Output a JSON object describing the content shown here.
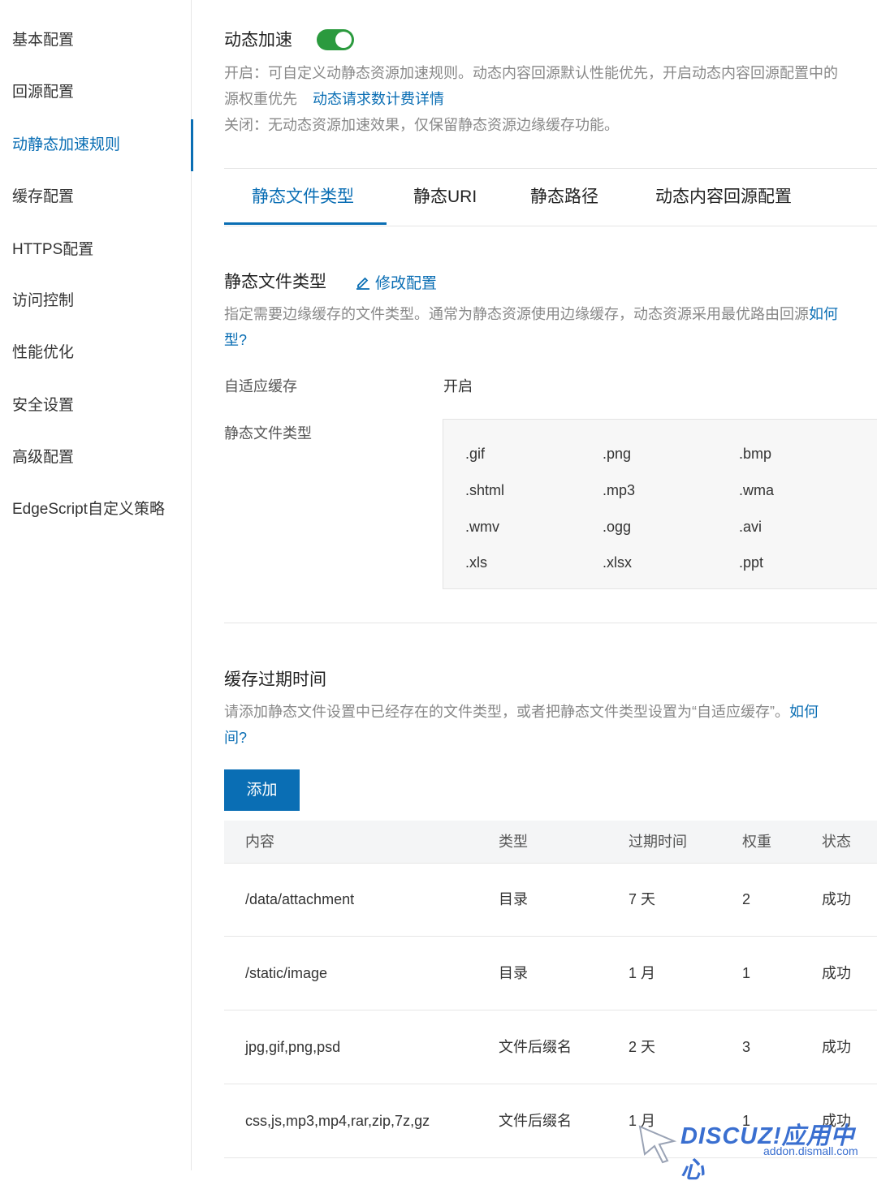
{
  "sidebar": {
    "items": [
      {
        "label": "基本配置"
      },
      {
        "label": "回源配置"
      },
      {
        "label": "动静态加速规则"
      },
      {
        "label": "缓存配置"
      },
      {
        "label": "HTTPS配置"
      },
      {
        "label": "访问控制"
      },
      {
        "label": "性能优化"
      },
      {
        "label": "安全设置"
      },
      {
        "label": "高级配置"
      },
      {
        "label": "EdgeScript自定义策略"
      }
    ]
  },
  "accel": {
    "title": "动态加速",
    "toggle_on": true,
    "desc_line1": "开启：可自定义动静态资源加速规则。动态内容回源默认性能优先，开启动态内容回源配置中的",
    "desc_line2_prefix": "源权重优先",
    "desc_link": "动态请求数计费详情",
    "desc_line3": "关闭：无动态资源加速效果，仅保留静态资源边缘缓存功能。"
  },
  "tabs": [
    {
      "label": "静态文件类型"
    },
    {
      "label": "静态URI"
    },
    {
      "label": "静态路径"
    },
    {
      "label": "动态内容回源配置"
    }
  ],
  "static_section": {
    "title": "静态文件类型",
    "edit_label": "修改配置",
    "desc_line1": "指定需要边缘缓存的文件类型。通常为静态资源使用边缘缓存，动态资源采用最优路由回源",
    "desc_link1": "如何",
    "desc_link2": "型?",
    "adaptive_label": "自适应缓存",
    "adaptive_value": "开启",
    "types_label": "静态文件类型",
    "extensions": [
      [
        ".gif",
        ".png",
        ".bmp"
      ],
      [
        ".shtml",
        ".mp3",
        ".wma"
      ],
      [
        ".wmv",
        ".ogg",
        ".avi"
      ],
      [
        ".xls",
        ".xlsx",
        ".ppt"
      ]
    ]
  },
  "cache_section": {
    "title": "缓存过期时间",
    "desc_line1": "请添加静态文件设置中已经存在的文件类型，或者把静态文件类型设置为“自适应缓存”。",
    "desc_link1": "如何",
    "desc_link2": "间?",
    "add_label": "添加",
    "columns": [
      "内容",
      "类型",
      "过期时间",
      "权重",
      "状态"
    ],
    "rows": [
      [
        "/data/attachment",
        "目录",
        "7 天",
        "2",
        "成功"
      ],
      [
        "/static/image",
        "目录",
        "1 月",
        "1",
        "成功"
      ],
      [
        "jpg,gif,png,psd",
        "文件后缀名",
        "2 天",
        "3",
        "成功"
      ],
      [
        "css,js,mp3,mp4,rar,zip,7z,gz",
        "文件后缀名",
        "1 月",
        "1",
        "成功"
      ]
    ]
  },
  "watermark": {
    "logo": "DISCUZ!应用中心",
    "url": "addon.dismall.com"
  }
}
